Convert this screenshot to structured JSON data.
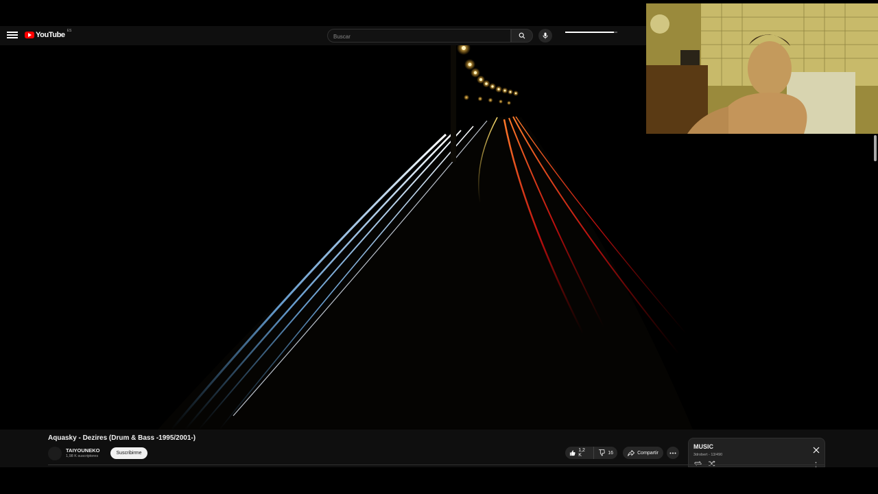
{
  "masthead": {
    "logo_text": "YouTube",
    "region_badge": "ES",
    "search_placeholder": "Buscar"
  },
  "video": {
    "title": "Aquasky - Dezires (Drum & Bass -1995/2001-)",
    "channel": {
      "name": "TAIYOUNEKO",
      "subscribers": "1,98 K suscriptores",
      "subscribe_label": "Suscribirme"
    },
    "actions": {
      "likes": "1,2 K",
      "dislikes": "16",
      "share_label": "Compartir",
      "like_ratio": 0.93
    }
  },
  "playlist": {
    "title": "MUSIC",
    "subtitle": "3drobert - 13/490"
  },
  "colors": {
    "background": "#000000",
    "masthead": "#0f0f0f",
    "brand_red": "#ff0000",
    "button_bg": "#272727"
  },
  "icons": {
    "menu": "menu-icon",
    "search": "search-icon",
    "mic": "mic-icon",
    "like": "thumbs-up-icon",
    "dislike": "thumbs-down-icon",
    "share": "share-icon",
    "more": "more-horizontal-icon",
    "close": "close-icon",
    "loop": "loop-icon",
    "shuffle": "shuffle-icon"
  }
}
